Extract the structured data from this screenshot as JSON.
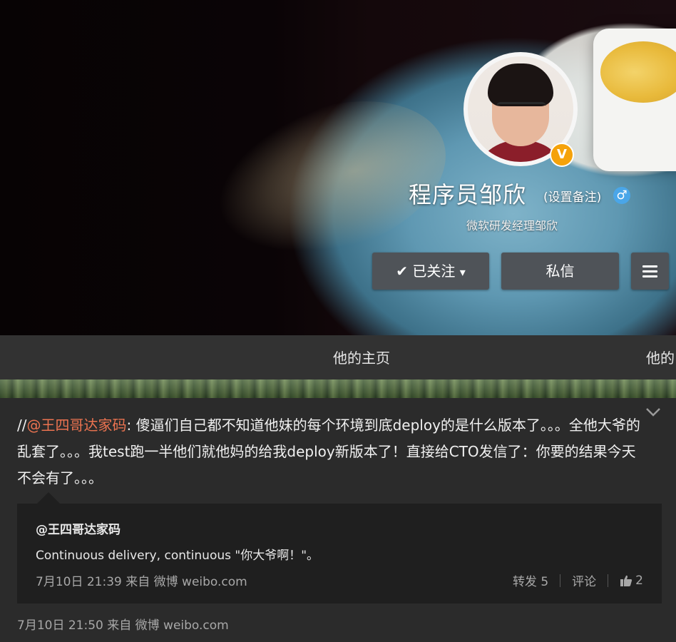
{
  "profile": {
    "name": "程序员邹欣",
    "remark_link": "(设置备注)",
    "gender_symbol": "♂",
    "verified_badge": "V",
    "bio": "微软研发经理邹欣"
  },
  "actions": {
    "follow_label": "已关注",
    "follow_check": "✔",
    "follow_caret": "▾",
    "message_label": "私信"
  },
  "tabs": [
    {
      "label": "他的主页"
    },
    {
      "label": "他的"
    }
  ],
  "post": {
    "prefix": "//",
    "mention": "@王四哥达家码",
    "text": ": 傻逼们自己都不知道他妹的每个环境到底deploy的是什么版本了。。。全他大爷的乱套了。。。我test跑一半他们就他妈的给我deploy新版本了！直接给CTO发信了：你要的结果今天不会有了。。。",
    "meta": "7月10日 21:50 来自 微博 weibo.com",
    "quoted": {
      "author": "@王四哥达家码",
      "text": "Continuous delivery, continuous \"你大爷啊！\"。",
      "meta": "7月10日 21:39 来自 微博 weibo.com",
      "repost_label": "转发 5",
      "comment_label": "评论",
      "like_count": "2"
    }
  },
  "icons": {
    "menu": "menu-icon",
    "chevron": "chevron-down-icon",
    "like": "thumbs-up-icon"
  },
  "colors": {
    "mention": "#eb7350",
    "verified": "#f5a20b",
    "gender": "#4aa6e8"
  }
}
